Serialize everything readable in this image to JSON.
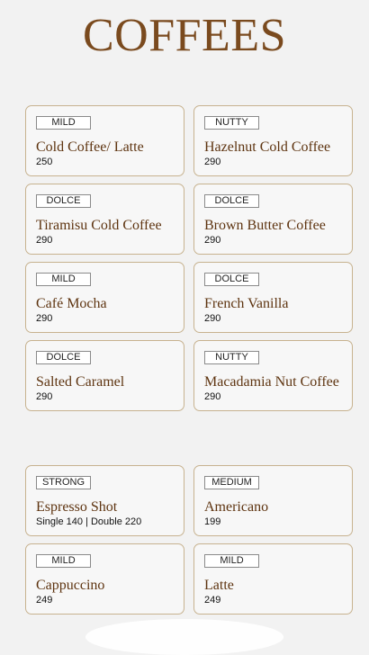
{
  "title": "COFFEES",
  "items": [
    {
      "tag": "MILD",
      "name": "Cold Coffee/ Latte",
      "price": "250"
    },
    {
      "tag": "NUTTY",
      "name": "Hazelnut Cold Coffee",
      "price": "290"
    },
    {
      "tag": "DOLCE",
      "name": "Tiramisu Cold Coffee",
      "price": "290"
    },
    {
      "tag": "DOLCE",
      "name": "Brown Butter Coffee",
      "price": "290"
    },
    {
      "tag": "MILD",
      "name": "Café Mocha",
      "price": "290"
    },
    {
      "tag": "DOLCE",
      "name": "French Vanilla",
      "price": "290"
    },
    {
      "tag": "DOLCE",
      "name": "Salted Caramel",
      "price": "290"
    },
    {
      "tag": "NUTTY",
      "name": "Macadamia Nut Coffee",
      "price": "290"
    },
    {
      "tag": "STRONG",
      "name": "Espresso Shot",
      "price": "Single 140 | Double 220"
    },
    {
      "tag": "MEDIUM",
      "name": "Americano",
      "price": "199"
    },
    {
      "tag": "MILD",
      "name": "Cappuccino",
      "price": "249"
    },
    {
      "tag": "MILD",
      "name": "Latte",
      "price": "249"
    }
  ]
}
